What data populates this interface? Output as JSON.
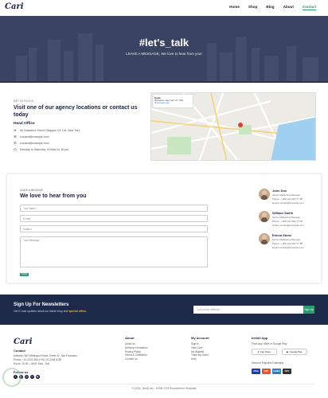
{
  "nav": {
    "logo": "Cari",
    "links": [
      "Home",
      "Shop",
      "Blog",
      "About",
      "Contact"
    ],
    "active": "Contact"
  },
  "hero": {
    "title": "#let's_talk",
    "subtitle": "LEAVE A MESSAGE, We love to hear from you!"
  },
  "contact": {
    "eyebrow": "GET IN TOUCH",
    "title": "Visit one of our agency locations or contact us today",
    "head_office": "Head Office",
    "address": "56 Glassford Street Glasgow G1 1UL New York",
    "email1": "contact@example.com",
    "email2": "contact@example.com",
    "hours": "Monday to Saturday: 9.00am to 16.pm"
  },
  "map": {
    "place": "SoHo",
    "place_sub": "Manhattan, New York, NY, USA",
    "link": "View larger map",
    "directions": "Directions",
    "district": "SECTOR V"
  },
  "form": {
    "eyebrow": "LEAVE A MESSAGE",
    "title": "We love to hear from you",
    "name_placeholder": "Your Name",
    "email_placeholder": "E-mail",
    "subject_placeholder": "Subject",
    "message_placeholder": "Your Message",
    "submit": "Submit"
  },
  "agents": [
    {
      "name": "John Doe",
      "role": "Senior Marketing Manager",
      "phone": "Phone: + 000 123 000 77 88",
      "email": "Email: contact@example.com"
    },
    {
      "name": "William Smith",
      "role": "Senior Marketing Manager",
      "phone": "Phone: + 000 123 000 77 88",
      "email": "Email: contact@example.com"
    },
    {
      "name": "Emma Stone",
      "role": "Senior Marketing Manager",
      "phone": "Phone: + 000 123 000 77 88",
      "email": "Email: contact@example.com"
    }
  ],
  "newsletter": {
    "title": "Sign Up For Newsletters",
    "sub_prefix": "Get E-mail updates about our latest shop and ",
    "sub_highlight": "special offers.",
    "placeholder": "Your email address",
    "button": "Sign Up"
  },
  "footer": {
    "logo": "Cari",
    "contact_head": "Contact",
    "address": "Address: 562 Wellington Road, Street 32, San Francisco",
    "phone": "Phone: +01 2222 365 /(+91) 01 2345 6789",
    "hours": "Hours: 10:00 - 18:00, Mon - Sat",
    "follow": "Follow us",
    "about_head": "About",
    "about_links": [
      "About us",
      "Delivery Information",
      "Privacy Policy",
      "Terms & Conditions",
      "Contact Us"
    ],
    "account_head": "My Account",
    "account_links": [
      "Sign In",
      "View Cart",
      "My Wishlist",
      "Track My Order",
      "Help"
    ],
    "app_head": "Install App",
    "app_sub": "From App Store or Google Play",
    "app_store": "App Store",
    "google_play": "Google Play",
    "payment": "Secured Payment Gateways",
    "cards": [
      "VISA",
      "MC",
      "AMEX",
      "PAY"
    ],
    "copyright": "© 2023, Tech2 etc - HTML CSS Ecommerce Template"
  },
  "colors": {
    "accent": "#2a9d6c",
    "navy": "#1b2240",
    "hero": "#3b4362",
    "newsletter": "#1d2a4a"
  }
}
